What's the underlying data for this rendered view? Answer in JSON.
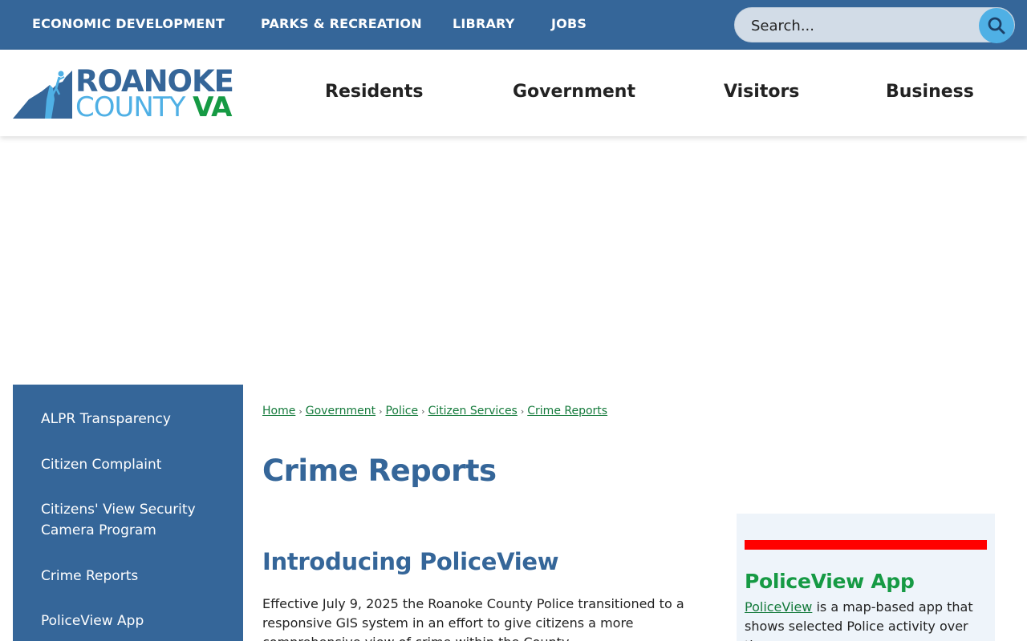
{
  "topnav": {
    "items": [
      {
        "label": "ECONOMIC DEVELOPMENT"
      },
      {
        "label": "PARKS & RECREATION"
      },
      {
        "label": "LIBRARY"
      },
      {
        "label": "JOBS"
      }
    ]
  },
  "search": {
    "placeholder": "Search...",
    "icon": "search-icon"
  },
  "logo": {
    "line1": "ROANOKE",
    "line2_county": "COUNTY",
    "line2_va": "VA"
  },
  "mainnav": {
    "items": [
      {
        "label": "Residents"
      },
      {
        "label": "Government"
      },
      {
        "label": "Visitors"
      },
      {
        "label": "Business"
      }
    ]
  },
  "sidebar": {
    "items": [
      {
        "label": "ALPR Transparency"
      },
      {
        "label": "Citizen Complaint"
      },
      {
        "label": "Citizens' View Security Camera Program"
      },
      {
        "label": "Crime Reports"
      },
      {
        "label": "PoliceView App"
      }
    ]
  },
  "breadcrumb": {
    "items": [
      {
        "label": "Home"
      },
      {
        "label": "Government"
      },
      {
        "label": "Police"
      },
      {
        "label": "Citizen Services"
      },
      {
        "label": "Crime Reports"
      }
    ],
    "separator": "›"
  },
  "main": {
    "title": "Crime Reports",
    "section_title": "Introducing PoliceView",
    "intro": "Effective July 9, 2025 the Roanoke County Police transitioned to a responsive GIS system in an effort to give citizens a more comprehensive view of crime within the County."
  },
  "aside": {
    "title": "PoliceView App",
    "link": "PoliceView",
    "text": " is a map-based app that shows selected Police activity over the"
  },
  "colors": {
    "primary_blue": "#356699",
    "light_blue": "#4fb0e5",
    "green": "#169a44",
    "link_green": "#147a3b",
    "alert_red": "#ff0000"
  }
}
